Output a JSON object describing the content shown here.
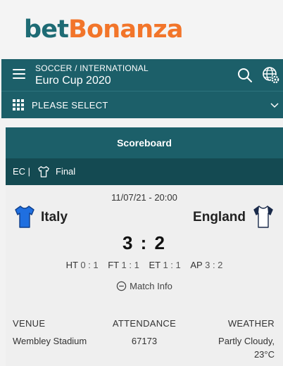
{
  "brand": {
    "part1": "bet",
    "part2": "Bonanza",
    "color_primary": "#1e6b74",
    "color_accent": "#f2752a"
  },
  "nav": {
    "breadcrumb": "SOCCER / INTERNATIONAL",
    "competition": "Euro Cup 2020",
    "icons": [
      "menu-icon",
      "search-icon",
      "globe-settings-icon"
    ]
  },
  "select": {
    "label": "PLEASE SELECT"
  },
  "scoreboard": {
    "title": "Scoreboard",
    "competition_code": "EC |",
    "stage": "Final",
    "datetime": "11/07/21 - 20:00",
    "home": {
      "name": "Italy",
      "shirt_color": "#1f6fe0"
    },
    "away": {
      "name": "England",
      "shirt_color": "#ffffff"
    },
    "score": "3 : 2",
    "periods": [
      {
        "label": "HT",
        "value": "0 : 1"
      },
      {
        "label": "FT",
        "value": "1 : 1"
      },
      {
        "label": "ET",
        "value": "1 : 1"
      },
      {
        "label": "AP",
        "value": "3 : 2"
      }
    ],
    "match_info_label": "Match Info",
    "details": {
      "venue_label": "VENUE",
      "venue": "Wembley Stadium",
      "attendance_label": "ATTENDANCE",
      "attendance": "67173",
      "weather_label": "WEATHER",
      "weather_line1": "Partly Cloudy,",
      "weather_line2": "23°C"
    }
  }
}
